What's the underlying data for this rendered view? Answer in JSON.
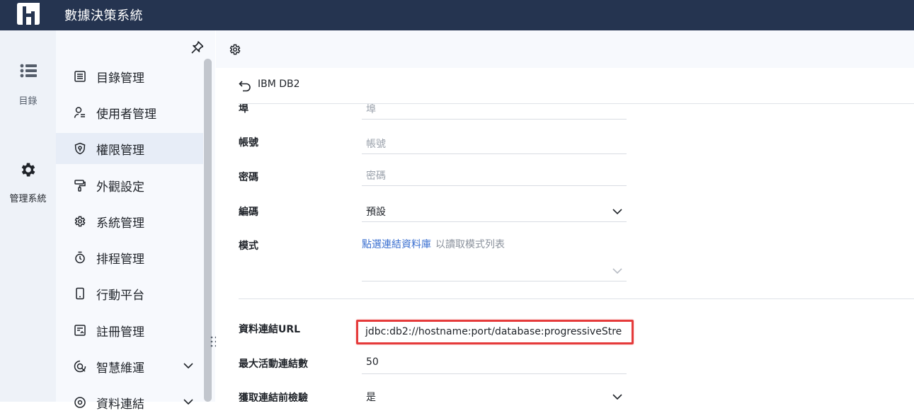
{
  "app": {
    "title": "數據決策系統"
  },
  "left_nav": {
    "items": [
      {
        "label": "目錄",
        "icon": "list-icon"
      },
      {
        "label": "管理系統",
        "icon": "gear-icon"
      }
    ]
  },
  "menu": {
    "items": [
      {
        "label": "目錄管理",
        "icon": "catalog-icon"
      },
      {
        "label": "使用者管理",
        "icon": "user-icon"
      },
      {
        "label": "權限管理",
        "icon": "shield-icon"
      },
      {
        "label": "外觀設定",
        "icon": "paint-roller-icon"
      },
      {
        "label": "系統管理",
        "icon": "gear-icon"
      },
      {
        "label": "排程管理",
        "icon": "timer-icon"
      },
      {
        "label": "行動平台",
        "icon": "mobile-icon"
      },
      {
        "label": "註冊管理",
        "icon": "register-icon"
      },
      {
        "label": "智慧維運",
        "icon": "maintenance-icon"
      },
      {
        "label": "資料連結",
        "icon": "data-link-icon"
      }
    ],
    "active_index": 2
  },
  "connection": {
    "title": "IBM DB2",
    "fields": {
      "port": {
        "label": "埠",
        "placeholder": "埠"
      },
      "account": {
        "label": "帳號",
        "placeholder": "帳號"
      },
      "password": {
        "label": "密碼",
        "placeholder": "密碼"
      },
      "encoding": {
        "label": "編碼",
        "value": "預設"
      },
      "schema": {
        "label": "模式",
        "link": "點選連結資料庫",
        "hint": "以讀取模式列表"
      },
      "url": {
        "label": "資料連結URL",
        "value": "jdbc:db2://hostname:port/database:progressiveStre"
      },
      "max_active": {
        "label": "最大活動連結數",
        "value": "50"
      },
      "test_before": {
        "label": "獲取連結前檢驗",
        "value": "是"
      }
    }
  },
  "colors": {
    "topbar": "#253450",
    "highlight_border": "#e53b3b",
    "link": "#3a6fd0"
  }
}
